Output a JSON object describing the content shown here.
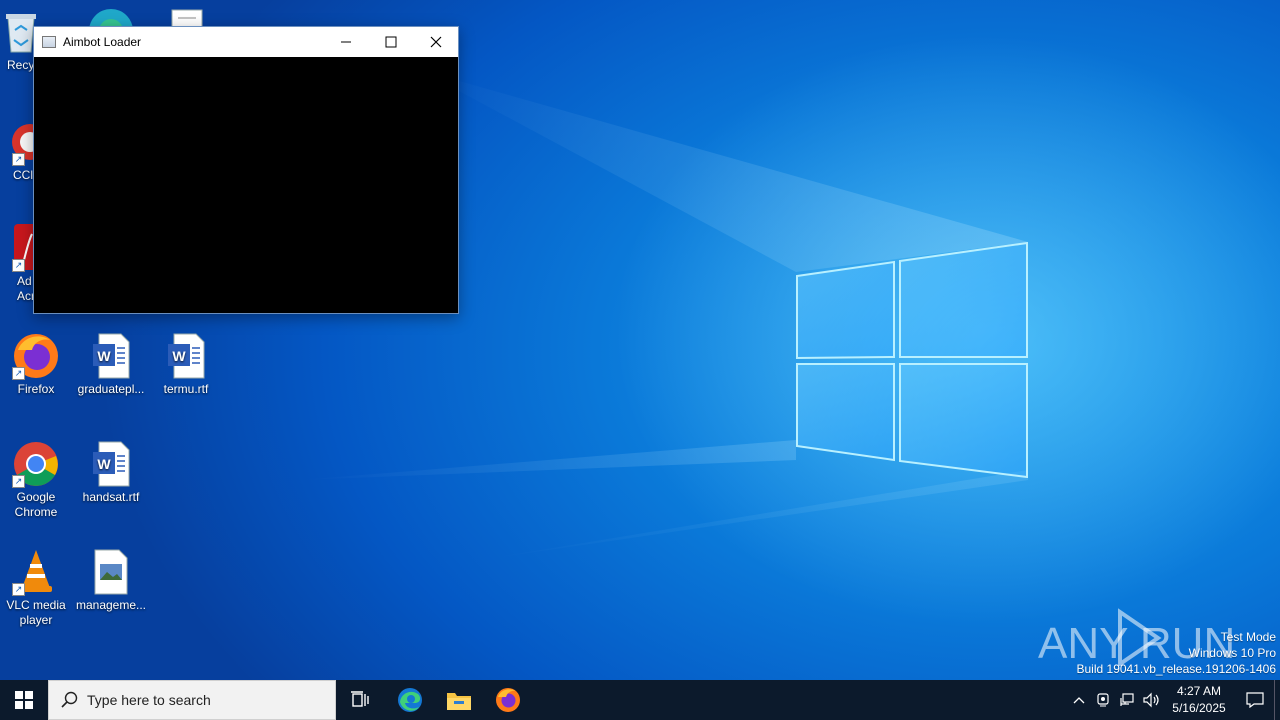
{
  "desktop": {
    "icons": [
      {
        "label": "Recy",
        "kind": "recycle-bin"
      },
      {
        "label": "CCl",
        "kind": "ccleaner"
      },
      {
        "label": "Ad Acr",
        "kind": "acrobat"
      },
      {
        "label": "Firefox",
        "kind": "firefox"
      },
      {
        "label": "graduatepl...",
        "kind": "word-doc"
      },
      {
        "label": "termu.rtf",
        "kind": "word-doc"
      },
      {
        "label": "Google Chrome",
        "kind": "chrome"
      },
      {
        "label": "handsat.rtf",
        "kind": "word-doc"
      },
      {
        "label": "VLC media player",
        "kind": "vlc"
      },
      {
        "label": "manageme...",
        "kind": "image-file"
      }
    ]
  },
  "window": {
    "title": "Aimbot Loader",
    "content_color": "#000000"
  },
  "taskbar": {
    "search_placeholder": "Type here to search",
    "pinned": [
      "task-view",
      "edge",
      "file-explorer",
      "firefox"
    ],
    "clock_time": "4:27 AM",
    "clock_date": "5/16/2025"
  },
  "watermark": {
    "brand": "ANY RUN",
    "line1": "Test Mode",
    "line2": "Windows 10 Pro",
    "line3": "Build 19041.vb_release.191206-1406"
  },
  "colors": {
    "taskbar_bg": "#0c1a2c",
    "desktop_accent": "#0a78d8"
  }
}
